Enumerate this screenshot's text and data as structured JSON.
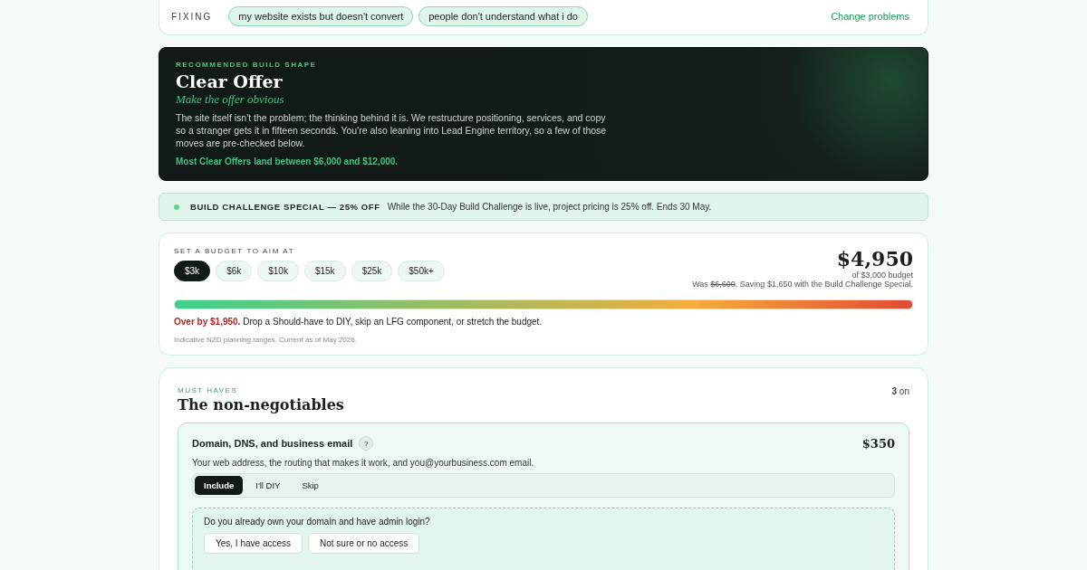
{
  "fixing": {
    "label": "FIXING",
    "problems": [
      "my website exists but doesn't convert",
      "people don't understand what i do"
    ],
    "change_link": "Change problems"
  },
  "hero": {
    "eyebrow": "RECOMMENDED BUILD SHAPE",
    "title": "Clear Offer",
    "tagline": "Make the offer obvious",
    "body": "The site itself isn't the problem; the thinking behind it is. We restructure positioning, services, and copy so a stranger gets it in fifteen seconds. You're also leaning into Lead Engine territory, so a few of those moves are pre-checked below.",
    "range": "Most Clear Offers land between $6,000 and $12,000."
  },
  "banner": {
    "title": "BUILD CHALLENGE SPECIAL — 25% OFF",
    "text": "While the 30-Day Build Challenge is live, project pricing is 25% off. Ends 30 May."
  },
  "budget": {
    "label": "SET A BUDGET TO AIM AT",
    "options": [
      {
        "label": "$3k",
        "selected": true
      },
      {
        "label": "$6k",
        "selected": false
      },
      {
        "label": "$10k",
        "selected": false
      },
      {
        "label": "$15k",
        "selected": false
      },
      {
        "label": "$25k",
        "selected": false
      },
      {
        "label": "$50k+",
        "selected": false
      }
    ],
    "total": "$4,950",
    "of_budget": "of $3,000 budget",
    "was_label": "Was",
    "was_price": "$6,600",
    "saving": ". Saving $1,650 with the Build Challenge Special.",
    "warning": "**Over by $1,950.** Drop a Should-have to DIY, skip an LFG component, or stretch the budget.",
    "footnote": "Indicative NZD planning ranges. Current as of May 2026."
  },
  "section": {
    "eyebrow": "MUST HAVES",
    "title": "The non-negotiables",
    "count": "**3** on",
    "items": [
      {
        "name": "Domain, DNS, and business email",
        "help": "?",
        "price": "$350",
        "description": "Your web address, the routing that makes it work, and you@yourbusiness.com email.",
        "choices": [
          {
            "label": "Include",
            "selected": true
          },
          {
            "label": "I'll DIY",
            "selected": false
          },
          {
            "label": "Skip",
            "selected": false
          }
        ],
        "question": "Do you already own your domain and have admin login?",
        "answers": [
          {
            "label": "Yes, I have access",
            "selected": false
          },
          {
            "label": "Not sure or no access",
            "selected": false
          }
        ]
      }
    ]
  }
}
